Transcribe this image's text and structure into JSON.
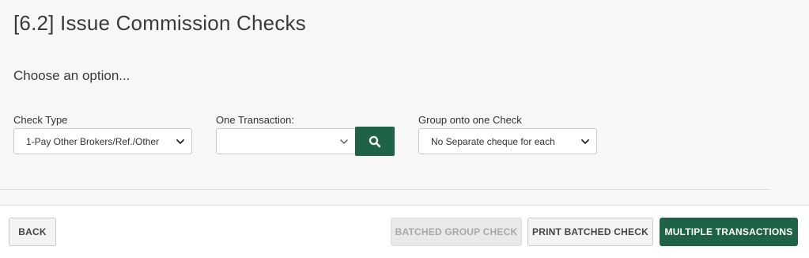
{
  "page": {
    "title": "[6.2] Issue Commission Checks",
    "subtitle": "Choose an option..."
  },
  "form": {
    "check_type": {
      "label": "Check Type",
      "value": "1-Pay Other Brokers/Ref./Other"
    },
    "one_transaction": {
      "label": "One Transaction:",
      "value": ""
    },
    "group": {
      "label": "Group onto one Check",
      "value": "No Separate cheque for each"
    }
  },
  "icons": {
    "search": "search-icon",
    "dropdown": "chevron-down-icon"
  },
  "footer": {
    "back_label": "BACK",
    "batched_group_label": "BATCHED GROUP CHECK",
    "print_batched_label": "PRINT BATCHED CHECK",
    "multiple_label": "MULTIPLE TRANSACTIONS"
  },
  "colors": {
    "primary": "#1e6347",
    "background": "#f7f7f7"
  }
}
